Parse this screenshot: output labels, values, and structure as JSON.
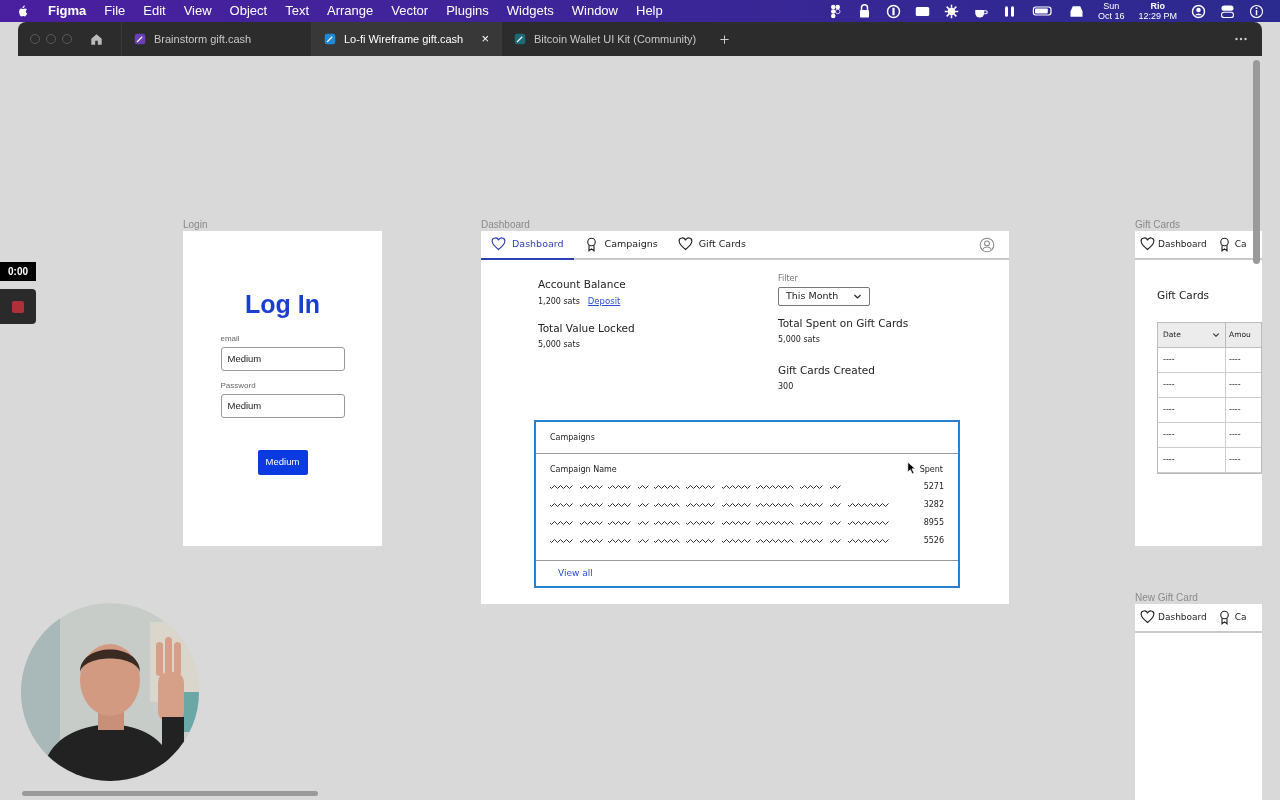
{
  "menu_bar": {
    "app": "Figma",
    "items": [
      "File",
      "Edit",
      "View",
      "Object",
      "Text",
      "Arrange",
      "Vector",
      "Plugins",
      "Widgets",
      "Window",
      "Help"
    ],
    "day": "Sun",
    "date": "Oct 16",
    "user": "Rio",
    "time": "12:29 PM"
  },
  "tabs": [
    {
      "label": "Brainstorm gift.cash",
      "selected": false
    },
    {
      "label": "Lo-fi Wireframe gift.cash",
      "selected": true,
      "close": "×"
    },
    {
      "label": "Bitcoin Wallet UI Kit (Community)",
      "selected": false
    }
  ],
  "recording": {
    "time": "0:00"
  },
  "login": {
    "label": "Login",
    "title": "Log In",
    "fields": [
      {
        "label": "email",
        "value": "Medium"
      },
      {
        "label": "Password",
        "value": "Medium"
      }
    ],
    "button": "Medium"
  },
  "dashboard": {
    "label": "Dashboard",
    "nav": [
      {
        "label": "Dashboard",
        "selected": true
      },
      {
        "label": "Campaigns",
        "selected": false
      },
      {
        "label": "Gift Cards",
        "selected": false
      }
    ],
    "stats_left": [
      {
        "title": "Account Balance",
        "value": "1,200 sats",
        "link": "Deposit"
      },
      {
        "title": "Total Value Locked",
        "value": "5,000 sats"
      }
    ],
    "filter": {
      "label": "Filter",
      "value": "This Month"
    },
    "stats_right": [
      {
        "title": "Total Spent on Gift Cards",
        "value": "5,000 sats"
      },
      {
        "title": "Gift Cards Created",
        "value": "300"
      }
    ],
    "campaigns": {
      "title": "Campaigns",
      "columns": [
        "Campaign Name",
        "Spent"
      ],
      "rows": [
        {
          "kind": "short",
          "spent": "5271"
        },
        {
          "kind": "long",
          "spent": "3282"
        },
        {
          "kind": "long",
          "spent": "8955"
        },
        {
          "kind": "long",
          "spent": "5526"
        }
      ],
      "footer_link": "View all"
    }
  },
  "gift_cards": {
    "label": "Gift Cards",
    "nav": [
      {
        "label": "Dashboard",
        "selected": false
      },
      {
        "label": "Ca",
        "selected": false
      }
    ],
    "heading": "Gift Cards",
    "columns": [
      "Date",
      "Amou"
    ],
    "rows": [
      [
        "----",
        "----"
      ],
      [
        "----",
        "----"
      ],
      [
        "----",
        "----"
      ],
      [
        "----",
        "----"
      ],
      [
        "----",
        "----"
      ]
    ]
  },
  "new_gift_card": {
    "label": "New Gift Card",
    "nav": [
      {
        "label": "Dashboard",
        "selected": false
      },
      {
        "label": "Ca",
        "selected": false
      }
    ]
  }
}
